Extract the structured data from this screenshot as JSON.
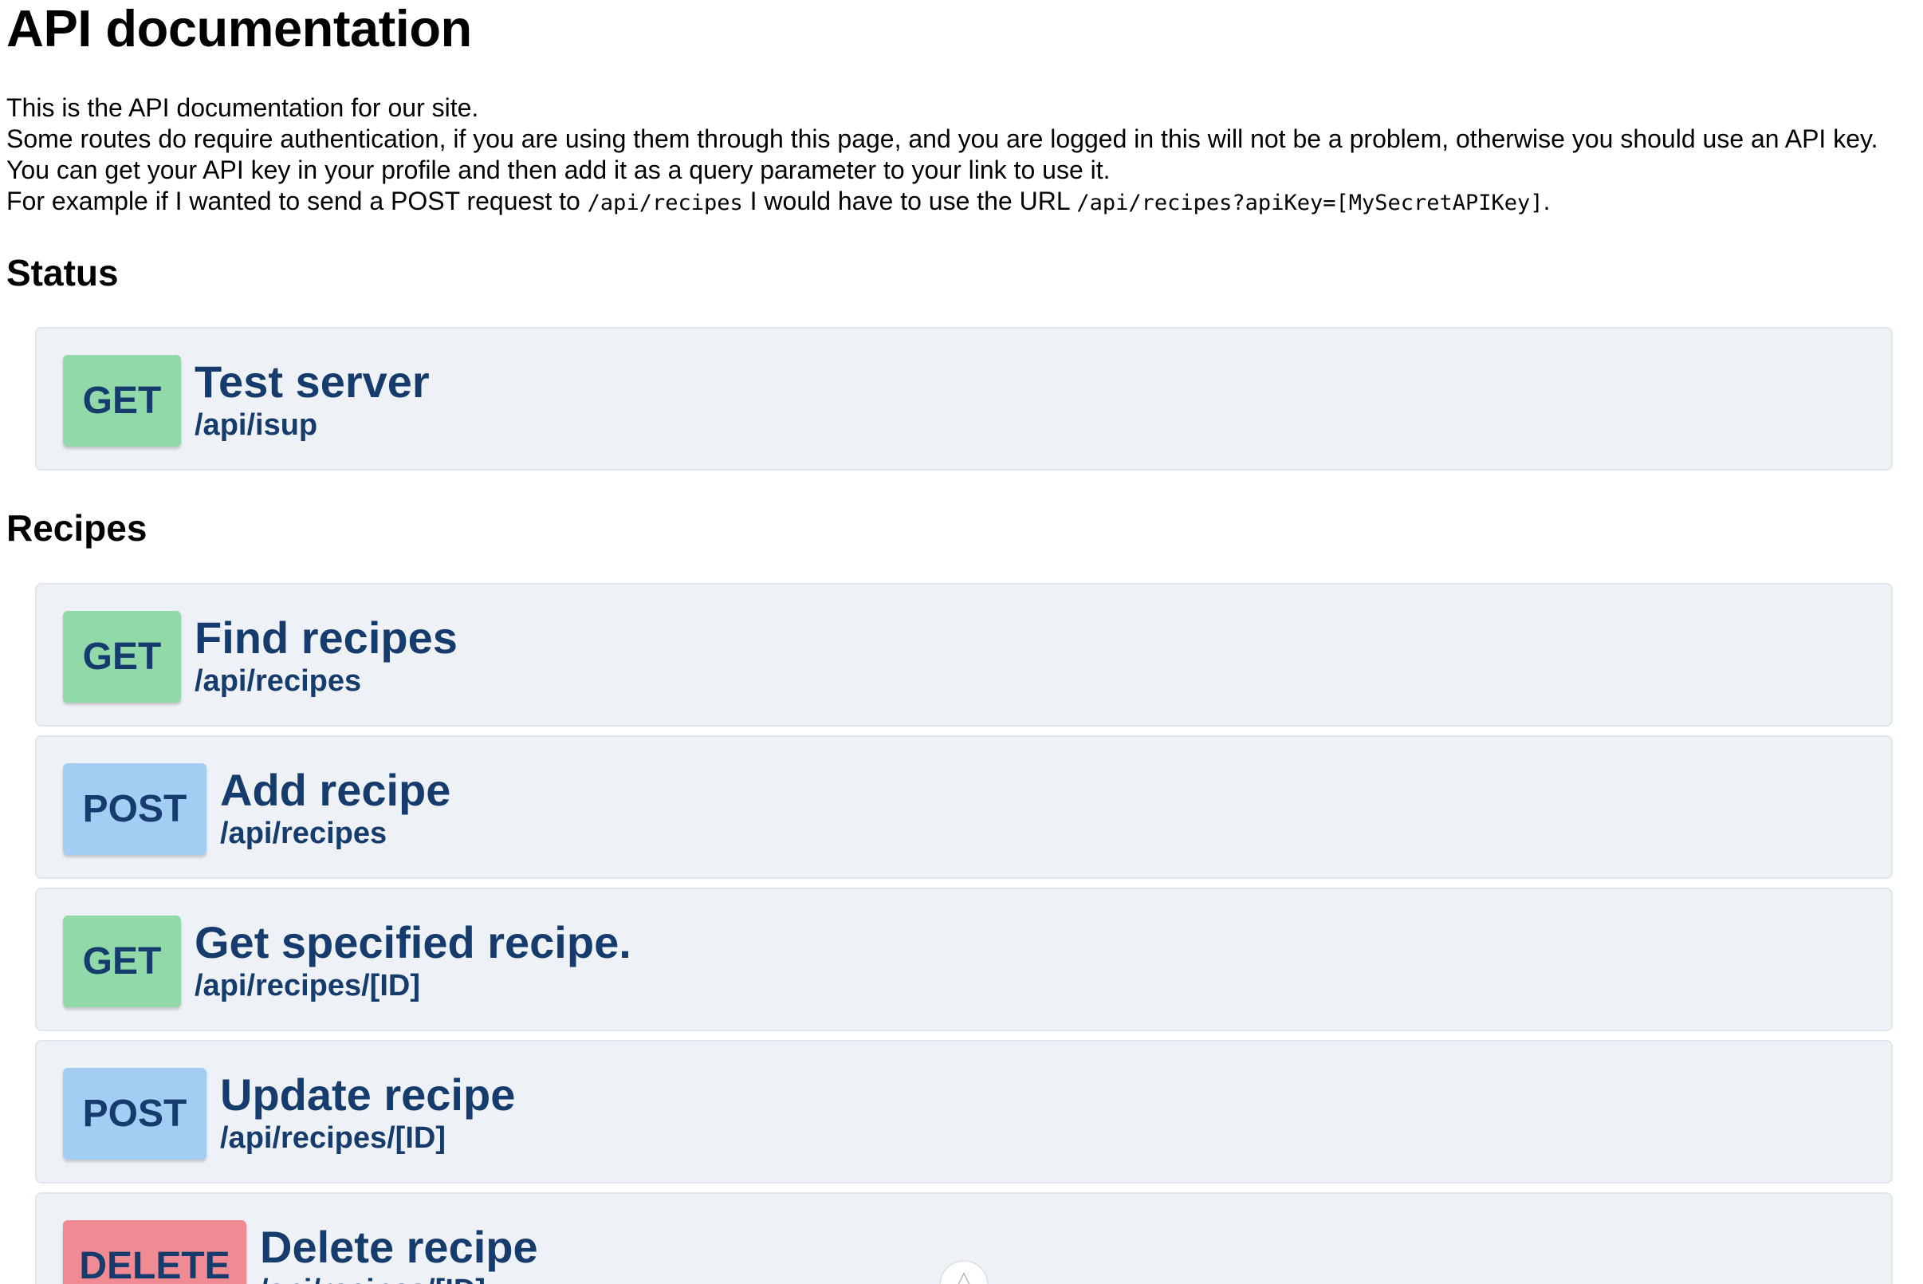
{
  "page": {
    "title": "API documentation",
    "intro": {
      "line1": "This is the API documentation for our site.",
      "line2": "Some routes do require authentication, if you are using them through this page, and you are logged in this will not be a problem, otherwise you should use an API key. You can get your API key in your profile and then add it as a query parameter to your link to use it.",
      "line3_prefix": "For example if I wanted to send a POST request to ",
      "line3_code1": "/api/recipes",
      "line3_middle": " I would have to use the URL ",
      "line3_code2": "/api/recipes?apiKey=[MySecretAPIKey]",
      "line3_suffix": "."
    }
  },
  "sections": [
    {
      "heading": "Status",
      "endpoints": [
        {
          "method": "GET",
          "title": "Test server",
          "route": "/api/isup"
        }
      ]
    },
    {
      "heading": "Recipes",
      "endpoints": [
        {
          "method": "GET",
          "title": "Find recipes",
          "route": "/api/recipes"
        },
        {
          "method": "POST",
          "title": "Add recipe",
          "route": "/api/recipes"
        },
        {
          "method": "GET",
          "title": "Get specified recipe.",
          "route": "/api/recipes/[ID]"
        },
        {
          "method": "POST",
          "title": "Update recipe",
          "route": "/api/recipes/[ID]"
        },
        {
          "method": "DELETE",
          "title": "Delete recipe",
          "route": "/api/recipes/[ID]"
        }
      ]
    }
  ],
  "colors": {
    "get": "#91d9a8",
    "post": "#a3cdf2",
    "delete": "#f08a93",
    "card_bg": "#eef2f7",
    "text_accent": "#163c6d"
  },
  "scroll_indicator": {
    "icon": "chevron-up-icon"
  }
}
